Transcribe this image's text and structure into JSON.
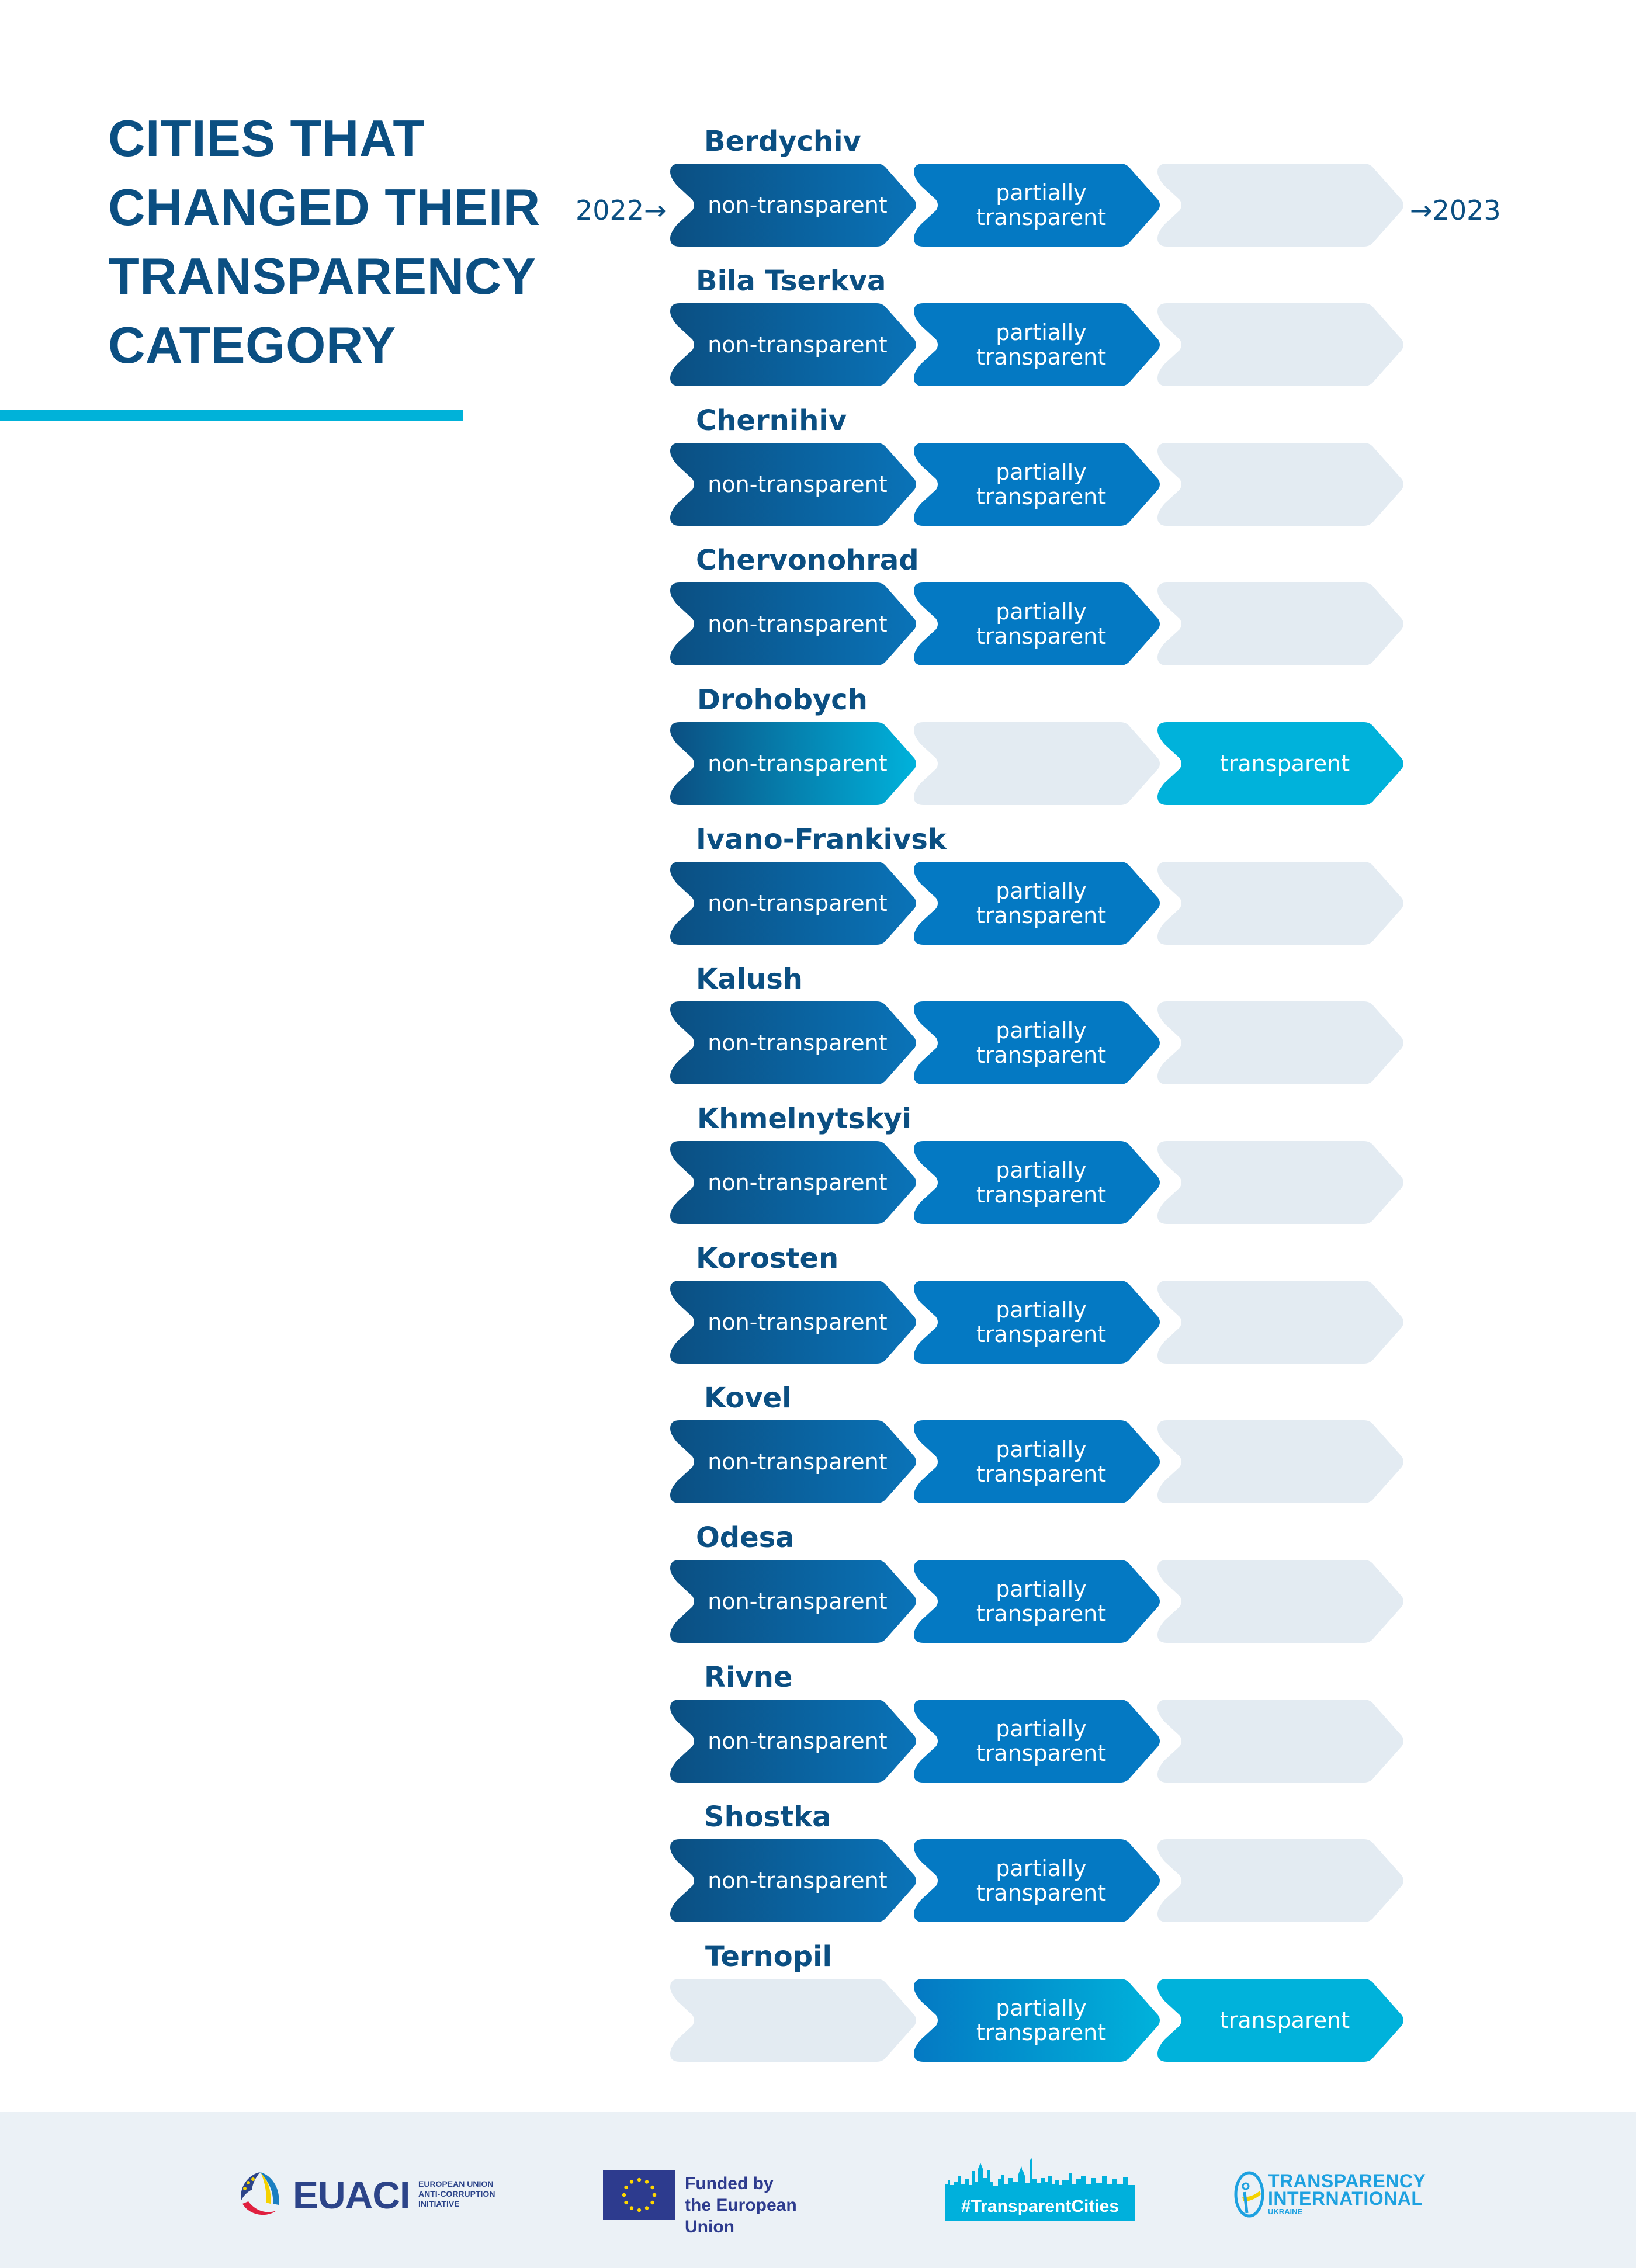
{
  "title": {
    "lines": [
      "CITIES THAT",
      "CHANGED THEIR",
      "TRANSPARENCY",
      "CATEGORY"
    ]
  },
  "timeline": {
    "start_year": "2022",
    "end_year": "2023",
    "start_arrow": "→",
    "end_arrow": "→"
  },
  "categories": {
    "non": "non-transparent",
    "partial_line1": "partially",
    "partial_line2": "transparent",
    "transparent": "transparent"
  },
  "colors": {
    "title": "#0b4f82",
    "accent_rule": "#00b2d9",
    "non_transparent_start": "#0b4f82",
    "non_transparent_end": "#0a73b8",
    "partially_transparent": "#0479c3",
    "transparent": "#00b2db",
    "empty": "#e3ebf2",
    "footer_bg": "#ebf1f6"
  },
  "chart_data": {
    "type": "table",
    "title": "Cities that changed their transparency category",
    "columns": [
      "non-transparent",
      "partially transparent",
      "transparent"
    ],
    "period": [
      "2022",
      "2023"
    ],
    "rows": [
      {
        "city": "Berdychiv",
        "from": "non-transparent",
        "to": "partially transparent",
        "states": [
          "non",
          "partial",
          "empty"
        ]
      },
      {
        "city": "Bila Tserkva",
        "from": "non-transparent",
        "to": "partially transparent",
        "states": [
          "non",
          "partial",
          "empty"
        ]
      },
      {
        "city": "Chernihiv",
        "from": "non-transparent",
        "to": "partially transparent",
        "states": [
          "non",
          "partial",
          "empty"
        ]
      },
      {
        "city": "Chervonohrad",
        "from": "non-transparent",
        "to": "partially transparent",
        "states": [
          "non",
          "partial",
          "empty"
        ]
      },
      {
        "city": "Drohobych",
        "from": "non-transparent",
        "to": "transparent",
        "states": [
          "non-fade",
          "empty",
          "transparent"
        ]
      },
      {
        "city": "Ivano-Frankivsk",
        "from": "non-transparent",
        "to": "partially transparent",
        "states": [
          "non",
          "partial",
          "empty"
        ]
      },
      {
        "city": "Kalush",
        "from": "non-transparent",
        "to": "partially transparent",
        "states": [
          "non",
          "partial",
          "empty"
        ]
      },
      {
        "city": "Khmelnytskyi",
        "from": "non-transparent",
        "to": "partially transparent",
        "states": [
          "non",
          "partial",
          "empty"
        ]
      },
      {
        "city": "Korosten",
        "from": "non-transparent",
        "to": "partially transparent",
        "states": [
          "non",
          "partial",
          "empty"
        ]
      },
      {
        "city": "Kovel",
        "from": "non-transparent",
        "to": "partially transparent",
        "states": [
          "non",
          "partial",
          "empty"
        ]
      },
      {
        "city": "Odesa",
        "from": "non-transparent",
        "to": "partially transparent",
        "states": [
          "non",
          "partial",
          "empty"
        ]
      },
      {
        "city": "Rivne",
        "from": "non-transparent",
        "to": "partially transparent",
        "states": [
          "non",
          "partial",
          "empty"
        ]
      },
      {
        "city": "Shostka",
        "from": "non-transparent",
        "to": "partially transparent",
        "states": [
          "non",
          "partial",
          "empty"
        ]
      },
      {
        "city": "Ternopil",
        "from": "partially transparent",
        "to": "transparent",
        "states": [
          "empty",
          "partial-fade",
          "transparent"
        ]
      }
    ]
  },
  "footer": {
    "euaci": {
      "name": "EUACI",
      "sub": [
        "EUROPEAN UNION",
        "ANTI-CORRUPTION",
        "INITIATIVE"
      ],
      "icon": "euaci-emblem-icon"
    },
    "eu": {
      "text": [
        "Funded by",
        "the European Union"
      ],
      "icon": "eu-flag-icon"
    },
    "transparent_cities": {
      "label": "#TransparentCities",
      "icon": "city-skyline-icon"
    },
    "ti": {
      "lines": [
        "TRANSPARENCY",
        "INTERNATIONAL",
        "UKRAINE"
      ],
      "icon": "ti-figure-icon"
    }
  }
}
